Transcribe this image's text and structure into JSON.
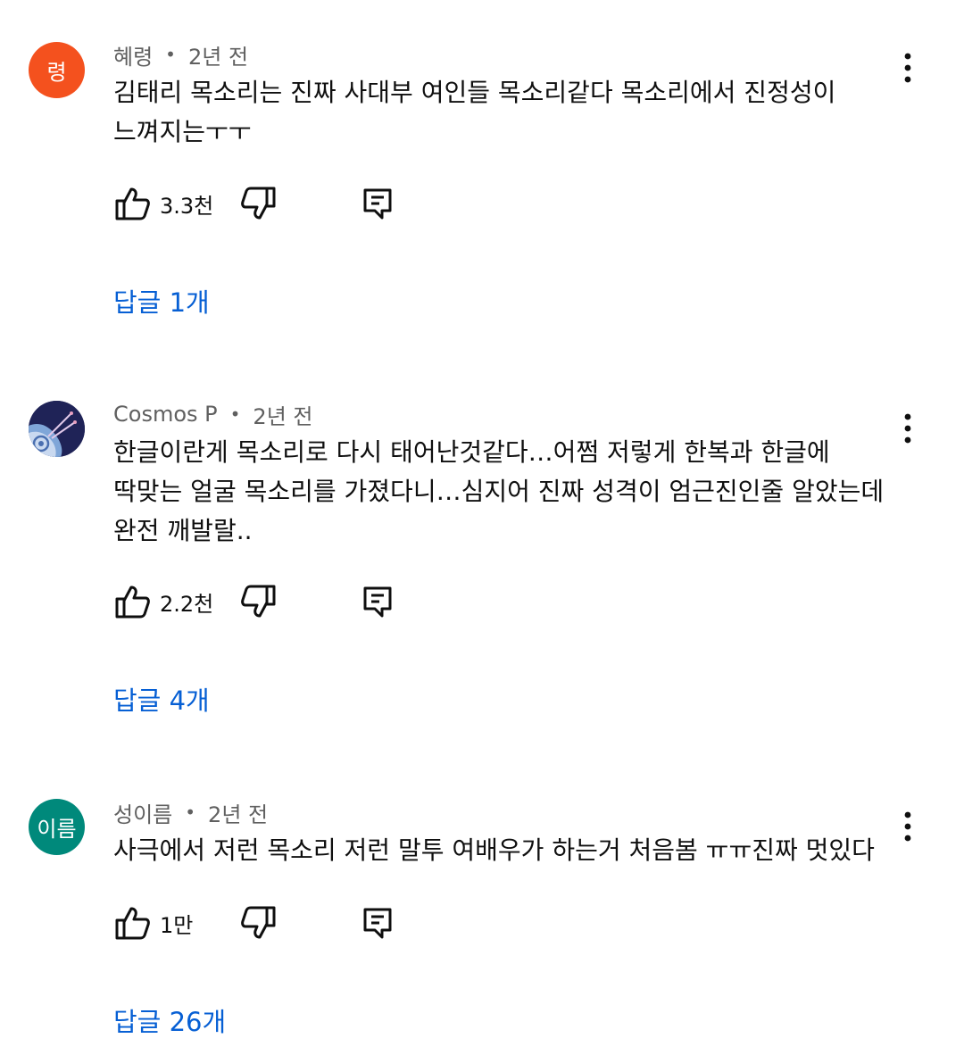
{
  "comments": [
    {
      "avatar_text": "령",
      "avatar_color": "#f4511e",
      "author": "혜령",
      "time": "2년 전",
      "text_lines": [
        "김태리 목소리는 진짜 사대부 여인들 목소리같다 목소리에서 진정성이",
        "느껴지는ㅜㅜ"
      ],
      "likes": "3.3천",
      "replies": "답글 1개"
    },
    {
      "avatar_text": "",
      "avatar_color": "#1f2357",
      "author": "Cosmos P",
      "time": "2년 전",
      "text_lines": [
        "한글이란게 목소리로 다시 태어난것같다…어쩜 저렇게 한복과 한글에",
        "딱맞는 얼굴 목소리를 가졌다니…심지어 진짜 성격이 엄근진인줄 알았는데",
        "완전 깨발랄.."
      ],
      "likes": "2.2천",
      "replies": "답글 4개"
    },
    {
      "avatar_text": "이름",
      "avatar_color": "#00897b",
      "author": "성이름",
      "time": "2년 전",
      "text_lines": [
        "사극에서 저런 목소리 저런 말투 여배우가 하는거 처음봄 ㅠㅠ진짜 멋있다"
      ],
      "likes": "1만",
      "replies": "답글 26개"
    }
  ],
  "icons": {
    "like": "thumbs-up-icon",
    "dislike": "thumbs-down-icon",
    "reply": "comment-icon",
    "more": "more-vert-icon"
  },
  "colors": {
    "link": "#065fd4",
    "meta": "#606060",
    "text": "#0f0f0f"
  }
}
